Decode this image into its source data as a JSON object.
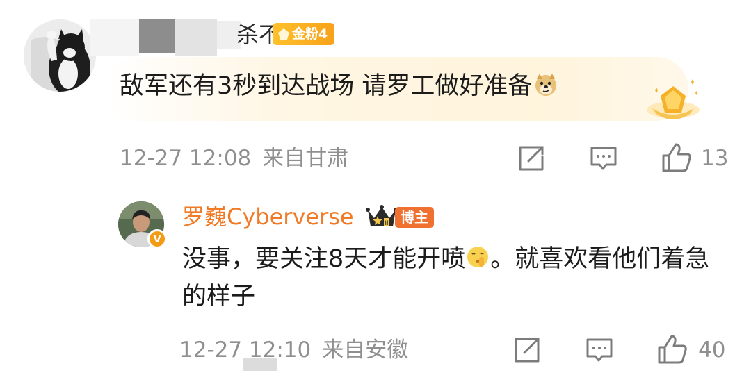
{
  "comments": [
    {
      "username_visible_tail": "杀不",
      "fan_badge": "金粉4",
      "text": "敌军还有3秒到达战场 请罗工做好准备",
      "time": "12-27 12:08",
      "location": "来自甘肃",
      "likes": "13",
      "avatar_icon": "cat-avatar",
      "emoji_icon": "doge-emoji",
      "decor_icon": "gold-gem-medal"
    },
    {
      "username": "罗巍Cyberverse",
      "role_badge": "博主",
      "text_before_emoji": "没事，要关注8天才能开喷",
      "text_after_emoji": "。就喜欢看他们着急的样子",
      "time": "12-27 12:10",
      "location": "来自安徽",
      "likes": "40",
      "avatar_icon": "person-avatar",
      "verified_badge": "V",
      "crown_icon": "crown-icon",
      "emoji_icon": "shush-emoji"
    }
  ],
  "colors": {
    "username_orange": "#f07a26",
    "fan_badge": "#f7a11b",
    "host_badge": "#f0702f",
    "meta_gray": "#8f8f8f",
    "highlight_bg": "#fff6e4"
  }
}
